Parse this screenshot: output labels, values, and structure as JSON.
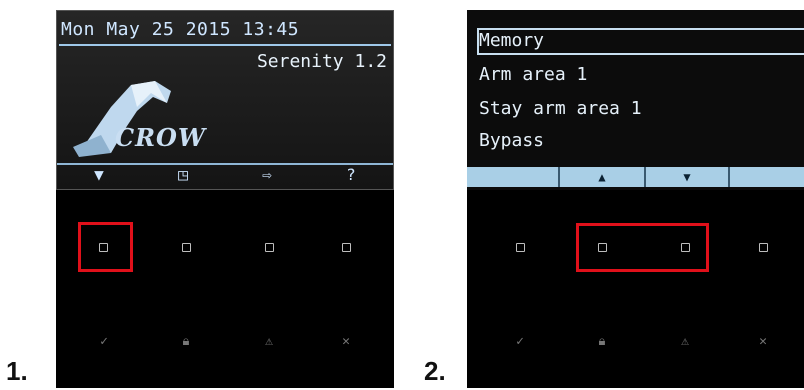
{
  "steps": {
    "label1": "1.",
    "label2": "2."
  },
  "screen1": {
    "clock": "Mon May 25 2015 13:45",
    "product": "Serenity 1.2",
    "logo_text": "CROW",
    "softkeys": [
      {
        "glyph": "▼",
        "icon": "arrow-down-icon"
      },
      {
        "glyph": "◳",
        "icon": "edit-icon"
      },
      {
        "glyph": "⇨",
        "icon": "exit-icon"
      },
      {
        "glyph": "?",
        "icon": "help-icon"
      }
    ]
  },
  "screen2": {
    "menu_items": [
      "Memory",
      "Arm area 1",
      "Stay arm area 1",
      "Bypass"
    ],
    "selected_index": 0,
    "softkeys": [
      {
        "glyph": "",
        "icon": ""
      },
      {
        "glyph": "▲",
        "icon": "arrow-up-icon"
      },
      {
        "glyph": "▼",
        "icon": "arrow-down-icon"
      },
      {
        "glyph": "",
        "icon": ""
      }
    ]
  },
  "function_keys": [
    {
      "glyph": "✓",
      "icon": "check-icon"
    },
    {
      "glyph": "🔒︎",
      "icon": "lock-icon"
    },
    {
      "glyph": "⚠︎",
      "icon": "warning-icon"
    },
    {
      "glyph": "✕",
      "icon": "close-icon"
    }
  ],
  "colors": {
    "highlight": "#e0101a",
    "screen_text": "#cfe6ff",
    "softbar2_bg": "#a9cfe6"
  }
}
